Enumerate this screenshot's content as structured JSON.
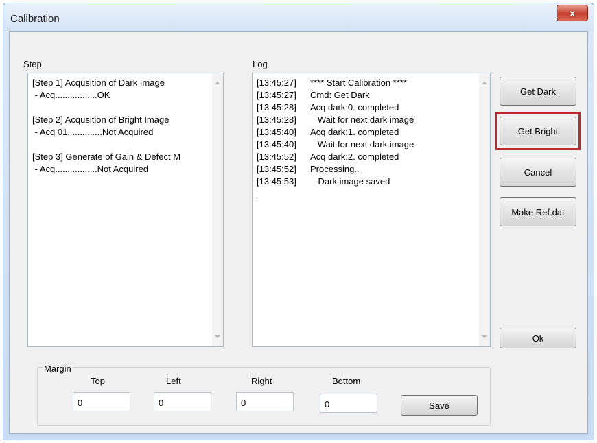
{
  "window": {
    "title": "Calibration",
    "close_label": "x"
  },
  "step": {
    "label": "Step",
    "lines": [
      "[Step 1] Acqusition of Dark Image",
      " - Acq.................OK",
      "",
      "[Step 2] Acqusition of Bright Image",
      " - Acq 01..............Not Acquired",
      "",
      "[Step 3] Generate of Gain & Defect M",
      " - Acq.................Not Acquired"
    ]
  },
  "log": {
    "label": "Log",
    "entries": [
      {
        "time": "[13:45:27]",
        "msg": "**** Start Calibration ****"
      },
      {
        "time": "[13:45:27]",
        "msg": "Cmd: Get Dark"
      },
      {
        "time": "[13:45:28]",
        "msg": "Acq dark:0. completed"
      },
      {
        "time": "[13:45:28]",
        "msg": "   Wait for next dark image"
      },
      {
        "time": "[13:45:40]",
        "msg": "Acq dark:1. completed"
      },
      {
        "time": "[13:45:40]",
        "msg": "   Wait for next dark image"
      },
      {
        "time": "[13:45:52]",
        "msg": "Acq dark:2. completed"
      },
      {
        "time": "[13:45:52]",
        "msg": "Processing.."
      },
      {
        "time": "[13:45:53]",
        "msg": " - Dark image saved"
      }
    ]
  },
  "buttons": {
    "get_dark": "Get Dark",
    "get_bright": "Get Bright",
    "cancel": "Cancel",
    "make_ref": "Make Ref.dat",
    "ok": "Ok",
    "save": "Save"
  },
  "margin": {
    "label": "Margin",
    "top_label": "Top",
    "left_label": "Left",
    "right_label": "Right",
    "bottom_label": "Bottom",
    "top_value": "0",
    "left_value": "0",
    "right_value": "0",
    "bottom_value": "0"
  },
  "colors": {
    "highlight": "#c0282d"
  },
  "icons": {
    "close": "close-icon",
    "scroll_up": "scroll-up-arrow-icon",
    "scroll_down": "scroll-down-arrow-icon"
  }
}
